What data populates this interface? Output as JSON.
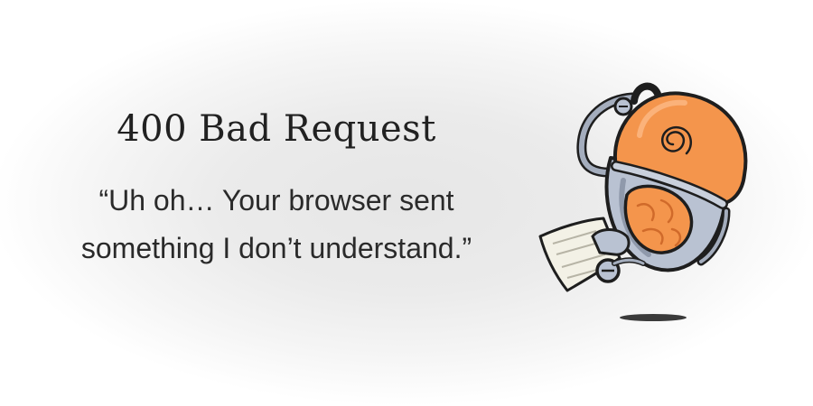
{
  "error": {
    "title": "400 Bad Request",
    "message_line1": "“Uh oh… Your browser sent",
    "message_line2": "something I don’t understand.”"
  },
  "illustration": {
    "icon": "robot-mascot-icon",
    "colors": {
      "orange": "#f4954c",
      "metal": "#b9c2d2",
      "outline": "#1e1e1e",
      "shadow": "#3a3a3a"
    }
  }
}
